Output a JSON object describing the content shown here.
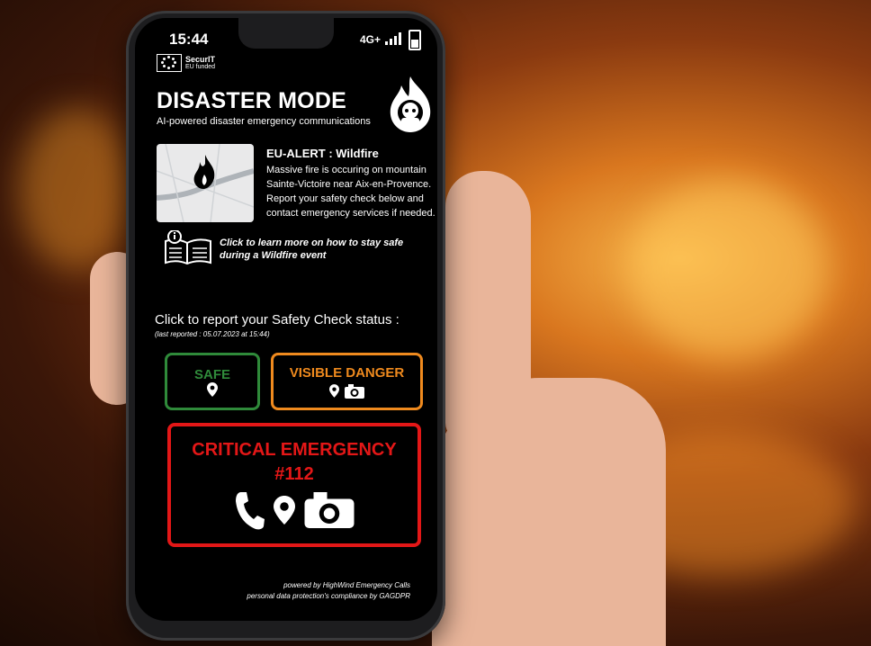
{
  "status_bar": {
    "time": "15:44",
    "network": "4G+"
  },
  "brand": {
    "name": "SecurIT",
    "funding": "EU funded"
  },
  "header": {
    "title": "DISASTER MODE",
    "subtitle": "AI-powered disaster emergency communications"
  },
  "alert": {
    "title": "EU-ALERT : Wildfire",
    "body": "Massive fire is occuring on mountain Sainte-Victoire near Aix-en-Provence. Report your safety check below and contact emergency services if needed."
  },
  "learn_more": {
    "text": "Click to learn more on how to stay safe during a Wildfire event"
  },
  "safety_check": {
    "prompt": "Click to report your Safety Check status :",
    "last_reported": "(last reported : 05.07.2023 at 15:44)"
  },
  "buttons": {
    "safe": {
      "label": "SAFE",
      "color": "#2f8a3a"
    },
    "danger": {
      "label": "VISIBLE DANGER",
      "color": "#ef8a1e"
    },
    "critical": {
      "label": "CRITICAL EMERGENCY",
      "number": "#112",
      "color": "#e31717"
    }
  },
  "footer": {
    "powered_by": "powered by HighWind Emergency Calls",
    "compliance": "personal data protection's compliance by GAGDPR"
  },
  "icons": [
    "fire-icon",
    "map-pin-icon",
    "camera-icon",
    "phone-icon",
    "book-info-icon"
  ]
}
